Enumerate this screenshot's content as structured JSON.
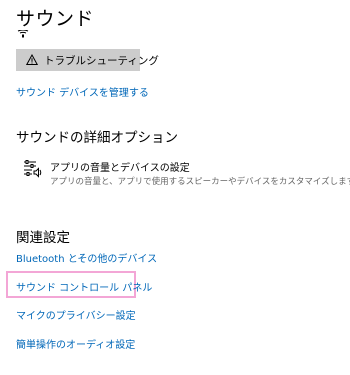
{
  "page": {
    "title": "サウンド"
  },
  "troubleshoot": {
    "label": "トラブルシューティング",
    "icon": "warning-icon"
  },
  "links": {
    "manage_devices": "サウンド デバイスを管理する"
  },
  "advanced": {
    "heading": "サウンドの詳細オプション",
    "item_title": "アプリの音量とデバイスの設定",
    "item_description": "アプリの音量と、アプリで使用するスピーカーやデバイスをカスタマイズします。",
    "icon": "volume-mixer-icon"
  },
  "related": {
    "heading": "関連設定",
    "items": [
      {
        "label": "Bluetooth とその他のデバイス"
      },
      {
        "label": "サウンド コントロール パネル",
        "highlighted": true
      },
      {
        "label": "マイクのプライバシー設定"
      },
      {
        "label": "簡単操作のオーディオ設定"
      }
    ]
  },
  "colors": {
    "link": "#0067b8",
    "button_bg": "#cccccc",
    "highlight_border": "#f3a6d6",
    "secondary_text": "#666666"
  }
}
